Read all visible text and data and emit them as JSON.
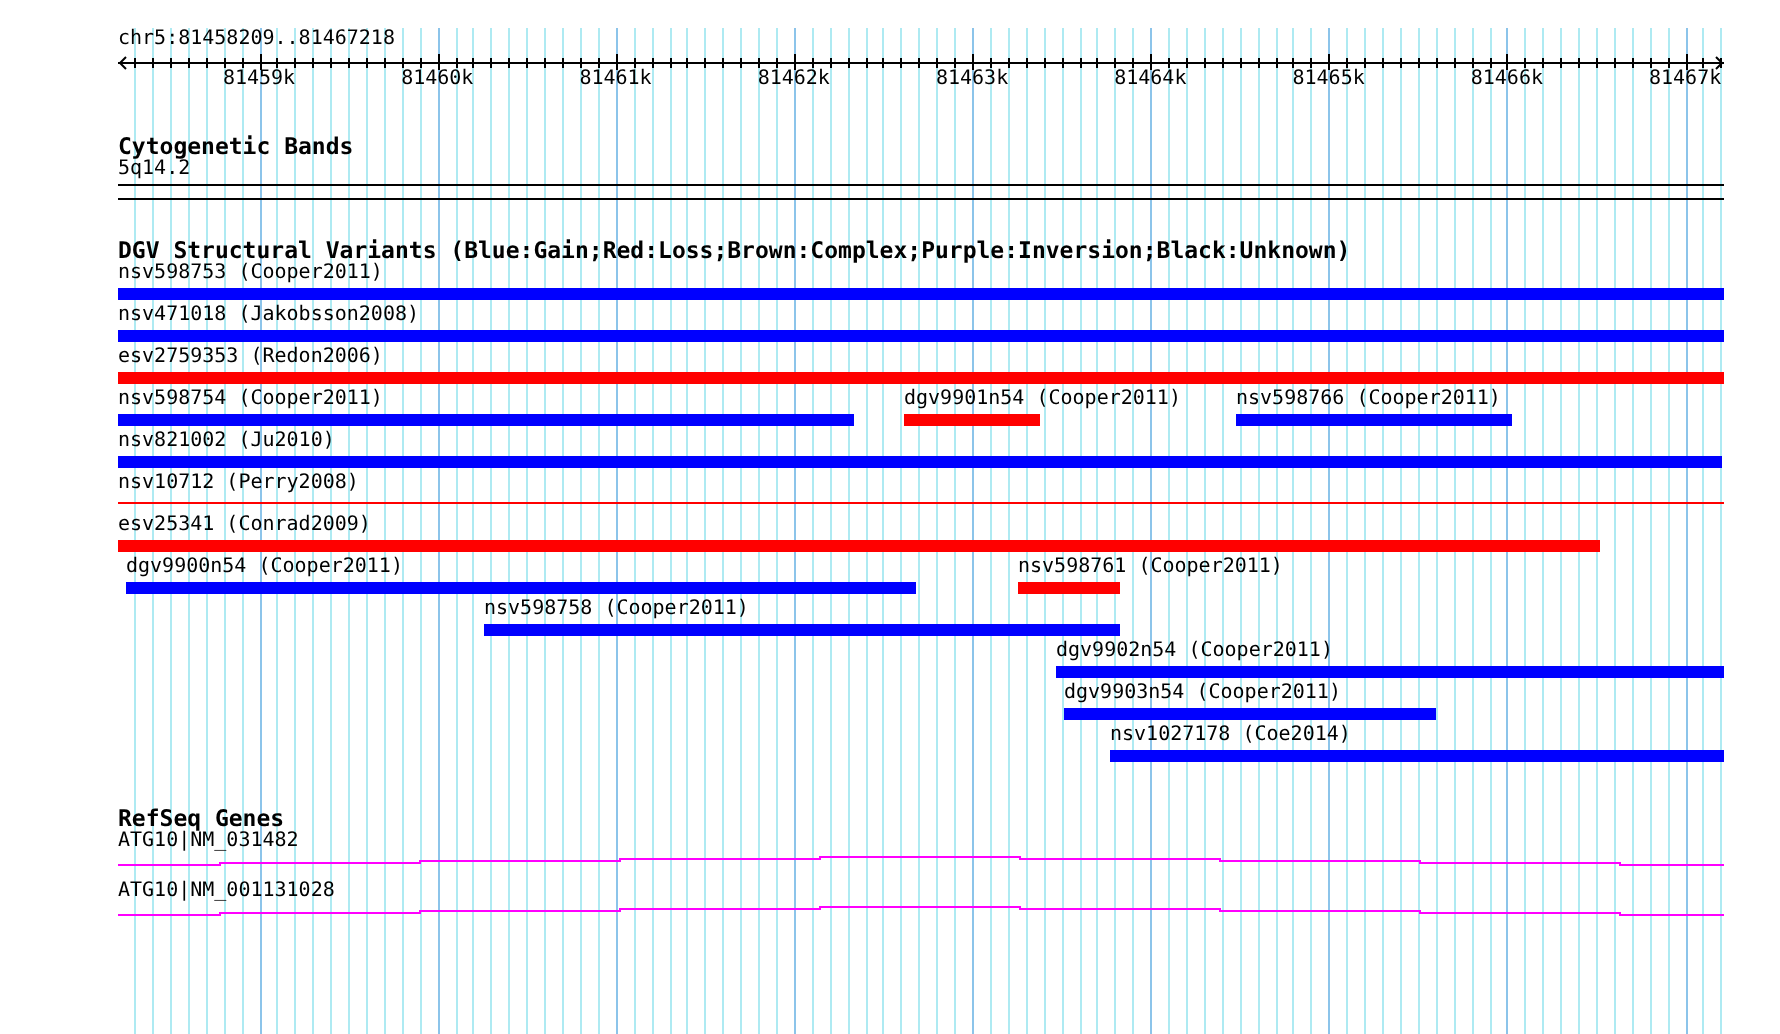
{
  "ruler": {
    "range": "chr5:81458209..81467218",
    "ticks": [
      "81459k",
      "81460k",
      "81461k",
      "81462k",
      "81463k",
      "81464k",
      "81465k",
      "81466k",
      "81467k"
    ]
  },
  "tracks": [
    {
      "kind": "cytoband",
      "title": "Cytogenetic Bands",
      "band": "5q14.2"
    },
    {
      "kind": "variants",
      "title": "DGV Structural Variants (Blue:Gain;Red:Loss;Brown:Complex;Purple:Inversion;Black:Unknown)",
      "rows": [
        {
          "features": [
            {
              "label": "nsv598753 (Cooper2011)",
              "kind": "bar",
              "color": "#0000ff"
            }
          ]
        },
        {
          "features": [
            {
              "label": "nsv471018 (Jakobsson2008)",
              "kind": "bar",
              "color": "#0000ff"
            }
          ]
        },
        {
          "features": [
            {
              "label": "esv2759353 (Redon2006)",
              "kind": "bar",
              "color": "#ff0000"
            }
          ]
        },
        {
          "features": [
            {
              "label": "nsv598754 (Cooper2011)",
              "kind": "bar",
              "color": "#0000ff"
            },
            {
              "label": "dgv9901n54 (Cooper2011)",
              "kind": "bar",
              "color": "#ff0000"
            },
            {
              "label": "nsv598766 (Cooper2011)",
              "kind": "bar",
              "color": "#0000ff"
            }
          ]
        },
        {
          "features": [
            {
              "label": "nsv821002 (Ju2010)",
              "kind": "bar",
              "color": "#0000ff"
            }
          ]
        },
        {
          "features": [
            {
              "label": "nsv10712 (Perry2008)",
              "kind": "line",
              "color": "#ff0000"
            }
          ]
        },
        {
          "features": [
            {
              "label": "esv25341 (Conrad2009)",
              "kind": "bar",
              "color": "#ff0000"
            }
          ]
        },
        {
          "features": [
            {
              "label": "dgv9900n54 (Cooper2011)",
              "kind": "bar",
              "color": "#0000ff"
            },
            {
              "label": "nsv598761 (Cooper2011)",
              "kind": "bar",
              "color": "#ff0000"
            }
          ]
        },
        {
          "features": [
            {
              "label": "nsv598758 (Cooper2011)",
              "kind": "bar",
              "color": "#0000ff"
            }
          ]
        },
        {
          "features": [
            {
              "label": "dgv9902n54 (Cooper2011)",
              "kind": "bar",
              "color": "#0000ff"
            }
          ]
        },
        {
          "features": [
            {
              "label": "dgv9903n54 (Cooper2011)",
              "kind": "bar",
              "color": "#0000ff"
            }
          ]
        },
        {
          "features": [
            {
              "label": "nsv1027178 (Coe2014)",
              "kind": "bar",
              "color": "#0000ff"
            }
          ]
        }
      ]
    },
    {
      "kind": "genes",
      "title": "RefSeq Genes",
      "genes": [
        {
          "label": "ATG10|NM_031482"
        },
        {
          "label": "ATG10|NM_001131028"
        }
      ]
    }
  ]
}
